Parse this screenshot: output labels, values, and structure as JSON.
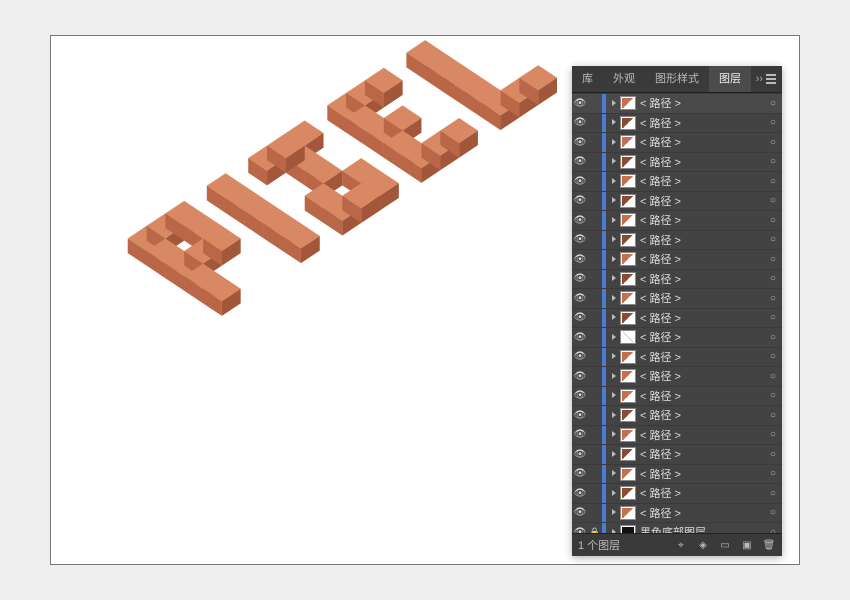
{
  "panel": {
    "tabs": [
      {
        "label": "库",
        "active": false
      },
      {
        "label": "外观",
        "active": false
      },
      {
        "label": "图形样式",
        "active": false
      },
      {
        "label": "图层",
        "active": true
      }
    ],
    "more_label": "›› ",
    "rows": [
      {
        "name": "< 路径 >",
        "thumb": "th-diag-o",
        "selected": true,
        "locked": false
      },
      {
        "name": "< 路径 >",
        "thumb": "th-diag-d",
        "selected": false,
        "locked": false
      },
      {
        "name": "< 路径 >",
        "thumb": "th-diag-o",
        "selected": false,
        "locked": false
      },
      {
        "name": "< 路径 >",
        "thumb": "th-diag-d",
        "selected": false,
        "locked": false
      },
      {
        "name": "< 路径 >",
        "thumb": "th-diag-o",
        "selected": false,
        "locked": false
      },
      {
        "name": "< 路径 >",
        "thumb": "th-diag-d",
        "selected": false,
        "locked": false
      },
      {
        "name": "< 路径 >",
        "thumb": "th-diag-o",
        "selected": false,
        "locked": false
      },
      {
        "name": "< 路径 >",
        "thumb": "th-diag-d",
        "selected": false,
        "locked": false
      },
      {
        "name": "< 路径 >",
        "thumb": "th-diag-o",
        "selected": false,
        "locked": false
      },
      {
        "name": "< 路径 >",
        "thumb": "th-diag-d",
        "selected": false,
        "locked": false
      },
      {
        "name": "< 路径 >",
        "thumb": "th-diag-o",
        "selected": false,
        "locked": false
      },
      {
        "name": "< 路径 >",
        "thumb": "th-diag-d",
        "selected": false,
        "locked": false
      },
      {
        "name": "< 路径 >",
        "thumb": "th-diag-m",
        "selected": false,
        "locked": false
      },
      {
        "name": "< 路径 >",
        "thumb": "th-diag-o",
        "selected": false,
        "locked": false
      },
      {
        "name": "< 路径 >",
        "thumb": "th-diag-o",
        "selected": false,
        "locked": false
      },
      {
        "name": "< 路径 >",
        "thumb": "th-diag-o",
        "selected": false,
        "locked": false
      },
      {
        "name": "< 路径 >",
        "thumb": "th-diag-d",
        "selected": false,
        "locked": false
      },
      {
        "name": "< 路径 >",
        "thumb": "th-diag-o",
        "selected": false,
        "locked": false
      },
      {
        "name": "< 路径 >",
        "thumb": "th-diag-d",
        "selected": false,
        "locked": false
      },
      {
        "name": "< 路径 >",
        "thumb": "th-diag-o",
        "selected": false,
        "locked": false
      },
      {
        "name": "< 路径 >",
        "thumb": "th-diag-d",
        "selected": false,
        "locked": false
      },
      {
        "name": "< 路径 >",
        "thumb": "th-diag-o",
        "selected": false,
        "locked": false
      },
      {
        "name": "黑色底部图层",
        "thumb": "th-black",
        "selected": false,
        "locked": true
      }
    ],
    "footer_label": "1 个图层",
    "footer_icons": [
      "locate-icon",
      "collect-icon",
      "new-sublayer-icon",
      "new-layer-icon",
      "delete-icon"
    ]
  },
  "artwork": {
    "word": "PIXEL",
    "colors": {
      "top": "#d88863",
      "left": "#b96746",
      "right": "#a2573a"
    }
  }
}
